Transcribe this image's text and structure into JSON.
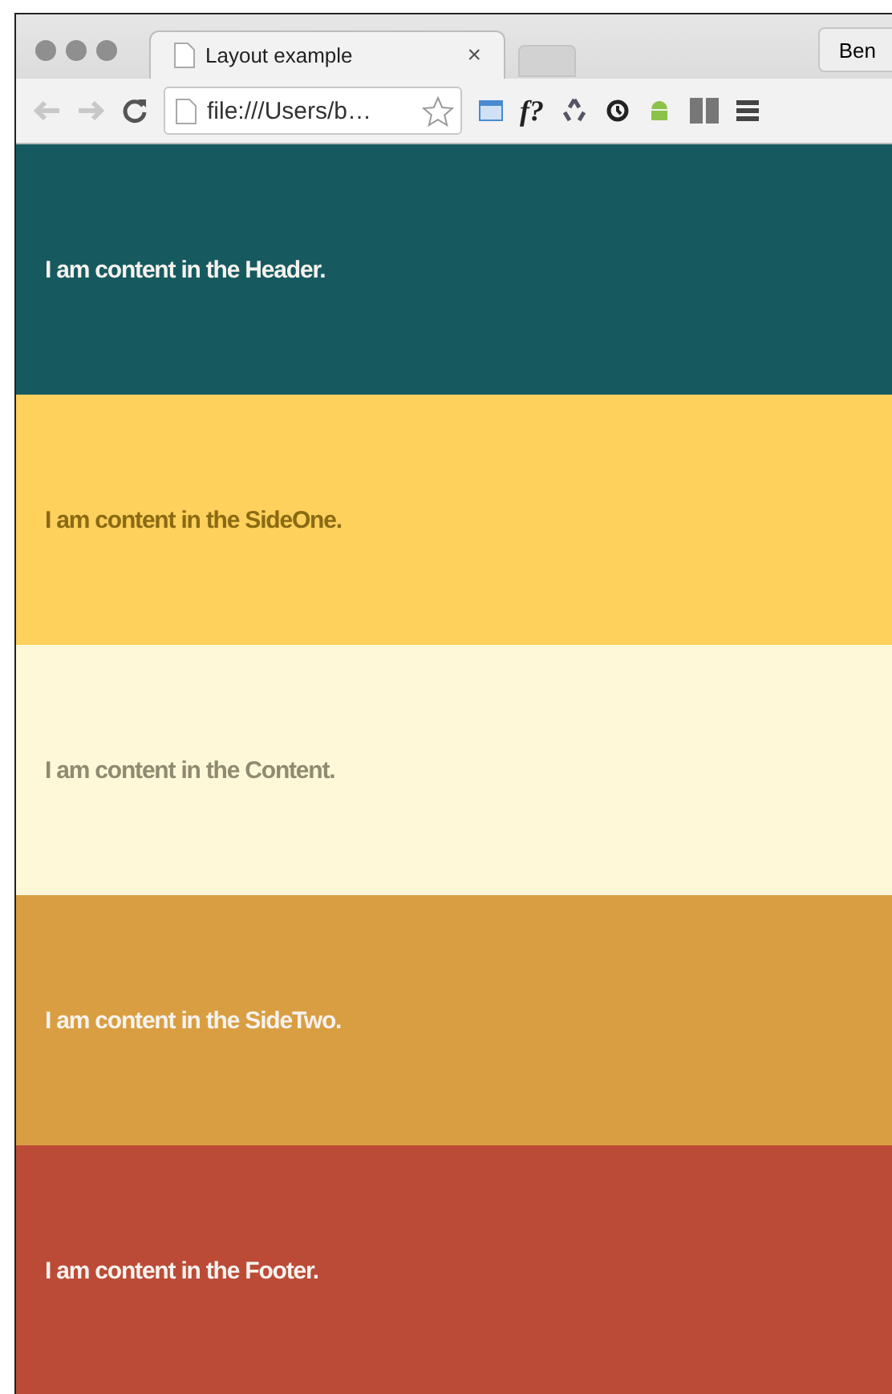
{
  "browser": {
    "tab": {
      "title": "Layout example",
      "close": "×",
      "selected": true
    },
    "profile": "Ben",
    "address": "file:///Users/b…",
    "extension_text": "f?"
  },
  "sections": [
    {
      "text": "I am content in the Header.",
      "color": "#165a60"
    },
    {
      "text": "I am content in the SideOne.",
      "color": "#fed05c"
    },
    {
      "text": "I am content in the Content.",
      "color": "#fff8d8"
    },
    {
      "text": "I am content in the SideTwo.",
      "color": "#d99e42"
    },
    {
      "text": "I am content in the Footer.",
      "color": "#bb4b37"
    }
  ]
}
